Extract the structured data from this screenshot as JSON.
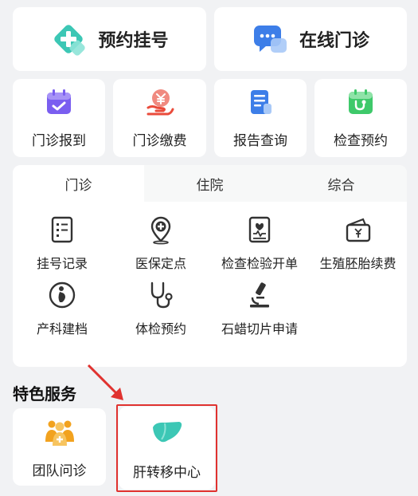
{
  "top_buttons": {
    "appointment": {
      "label": "预约挂号",
      "icon": "medical-cross-diamond-icon"
    },
    "online_clinic": {
      "label": "在线门诊",
      "icon": "chat-bubble-icon"
    }
  },
  "quick_actions": [
    {
      "label": "门诊报到",
      "icon": "calendar-check-icon"
    },
    {
      "label": "门诊缴费",
      "icon": "yen-payment-icon"
    },
    {
      "label": "报告查询",
      "icon": "report-document-icon"
    },
    {
      "label": "检查预约",
      "icon": "stethoscope-calendar-icon"
    }
  ],
  "tabs": [
    "门诊",
    "住院",
    "综合"
  ],
  "active_tab": "门诊",
  "clinic_items": [
    {
      "label": "挂号记录",
      "icon": "record-list-icon"
    },
    {
      "label": "医保定点",
      "icon": "location-pin-plus-icon"
    },
    {
      "label": "检查检验开单",
      "icon": "heartbeat-document-icon"
    },
    {
      "label": "生殖胚胎续费",
      "icon": "yen-wallet-icon"
    },
    {
      "label": "产科建档",
      "icon": "pregnancy-icon"
    },
    {
      "label": "体检预约",
      "icon": "stethoscope-icon"
    },
    {
      "label": "石蜡切片申请",
      "icon": "microscope-icon"
    }
  ],
  "featured": {
    "title": "特色服务",
    "items": [
      {
        "label": "团队问诊",
        "icon": "medical-team-icon"
      },
      {
        "label": "肝转移中心",
        "icon": "liver-icon"
      }
    ]
  },
  "colors": {
    "background": "#f1f2f4",
    "teal": "#3cc7b5",
    "blue": "#3d7ee8",
    "purple": "#7a5ef0",
    "red": "#ea4b3b",
    "green": "#3ec96a",
    "orange": "#f2a21e",
    "highlight": "#e0322f"
  }
}
